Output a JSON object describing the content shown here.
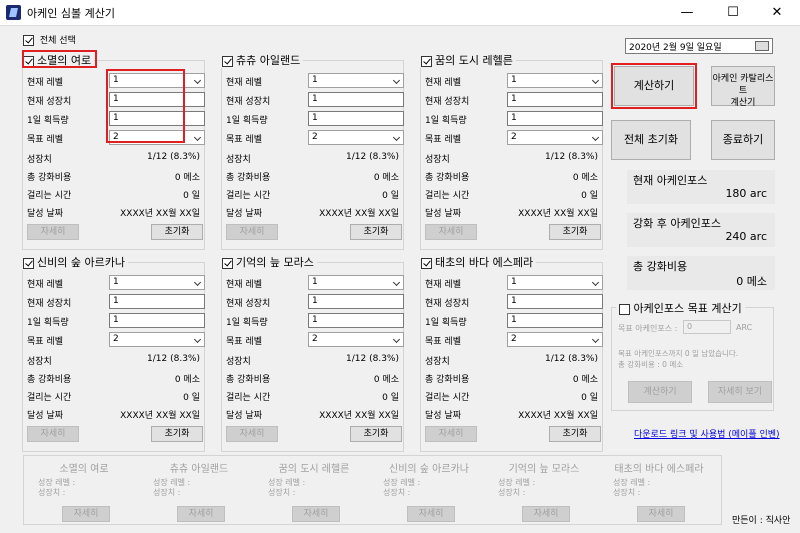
{
  "window": {
    "title": "아케인 심볼 계산기",
    "min": "—",
    "max": "☐",
    "close": "✕"
  },
  "select_all": "전체 선택",
  "date": "2020년  2월  9일 일요일",
  "fields": {
    "current_level": "현재 레벨",
    "current_growth": "현재 성장치",
    "daily_gain": "1일 획득량",
    "target_level": "목표 레벨",
    "growth": "성장치",
    "total_cost": "총 강화비용",
    "time": "걸리는 시간",
    "date": "달성 날짜"
  },
  "panels": [
    {
      "name": "소멸의 여로",
      "current_level": "1",
      "current_growth": "1",
      "daily_gain": "1",
      "target_level": "2",
      "growth": "1/12 (8.3%)",
      "cost": "0 메소",
      "time": "0 일",
      "date": "XXXX년 XX월 XX일",
      "detail": "자세히",
      "reset": "초기화"
    },
    {
      "name": "츄츄 아일랜드",
      "current_level": "1",
      "current_growth": "1",
      "daily_gain": "1",
      "target_level": "2",
      "growth": "1/12 (8.3%)",
      "cost": "0 메소",
      "time": "0 일",
      "date": "XXXX년 XX월 XX일",
      "detail": "자세히",
      "reset": "초기화"
    },
    {
      "name": "꿈의 도시 레헬른",
      "current_level": "1",
      "current_growth": "1",
      "daily_gain": "1",
      "target_level": "2",
      "growth": "1/12 (8.3%)",
      "cost": "0 메소",
      "time": "0 일",
      "date": "XXXX년 XX월 XX일",
      "detail": "자세히",
      "reset": "초기화"
    },
    {
      "name": "신비의 숲 아르카나",
      "current_level": "1",
      "current_growth": "1",
      "daily_gain": "1",
      "target_level": "2",
      "growth": "1/12 (8.3%)",
      "cost": "0 메소",
      "time": "0 일",
      "date": "XXXX년 XX월 XX일",
      "detail": "자세히",
      "reset": "초기화"
    },
    {
      "name": "기억의 늪 모라스",
      "current_level": "1",
      "current_growth": "1",
      "daily_gain": "1",
      "target_level": "2",
      "growth": "1/12 (8.3%)",
      "cost": "0 메소",
      "time": "0 일",
      "date": "XXXX년 XX월 XX일",
      "detail": "자세히",
      "reset": "초기화"
    },
    {
      "name": "태초의 바다 에스페라",
      "current_level": "1",
      "current_growth": "1",
      "daily_gain": "1",
      "target_level": "2",
      "growth": "1/12 (8.3%)",
      "cost": "0 메소",
      "time": "0 일",
      "date": "XXXX년 XX월 XX일",
      "detail": "자세히",
      "reset": "초기화"
    }
  ],
  "right": {
    "calc": "계산하기",
    "catalyst_line1": "아케인 카탈리스트",
    "catalyst_line2": "계산기",
    "reset_all": "전체 초기화",
    "exit": "종료하기",
    "current_af_label": "현재 아케인포스",
    "current_af": "180 arc",
    "after_af_label": "강화 후 아케인포스",
    "after_af": "240 arc",
    "total_cost_label": "총 강화비용",
    "total_cost": "0 메소"
  },
  "target_calc": {
    "title": "아케인포스 목표 계산기",
    "label": "목표 아케인포스 :",
    "value": "0",
    "unit": "ARC",
    "msg1": "목표 아케인포스까지 0 일 남았습니다.",
    "msg2": "총 강화비용 : 0 메소",
    "calc": "계산하기",
    "detail": "자세히 보기"
  },
  "link": "다운로드 링크 및 사용법 (메이플 인벤)",
  "summary": {
    "growth_label": "성장 레벨 :",
    "value_label": "성장치 :",
    "detail": "자세히",
    "names": [
      "소멸의 여로",
      "츄츄 아일랜드",
      "꿈의 도시 레헬른",
      "신비의 숲 아르카나",
      "기억의 늪 모라스",
      "태초의 바다 에스페라"
    ]
  },
  "author": "만든이 : 직사안",
  "colors": {
    "highlight": "#e02020",
    "link": "#0000dd"
  }
}
